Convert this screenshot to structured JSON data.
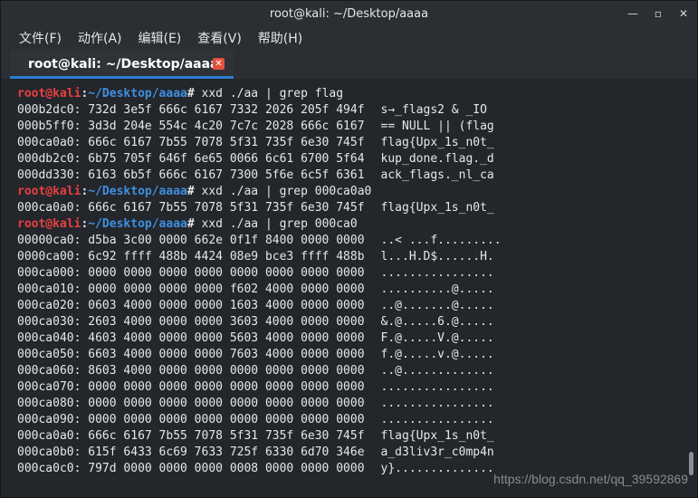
{
  "window": {
    "title": "root@kali: ~/Desktop/aaaa",
    "controls": [
      "—",
      "▫",
      "✕"
    ]
  },
  "menubar": {
    "items": [
      "文件(F)",
      "动作(A)",
      "编辑(E)",
      "查看(V)",
      "帮助(H)"
    ]
  },
  "tab": {
    "label": "root@kali: ~/Desktop/aaaa",
    "close_glyph": "✕",
    "accent_color": "#2f7bd0"
  },
  "terminal": {
    "lines": [
      {
        "type": "prompt",
        "user": "root@kali",
        "path": "~/Desktop/aaaa",
        "sep": "#",
        "cmd": "xxd ./aa | grep flag"
      },
      {
        "type": "hex",
        "addr": "000b2dc0:",
        "hex": "732d 3e5f 666c 6167 7332 2026 205f 494f",
        "ascii": "s→_flags2 & _IO"
      },
      {
        "type": "hex",
        "addr": "000b5ff0:",
        "hex": "3d3d 204e 554c 4c20 7c7c 2028 666c 6167",
        "ascii": "== NULL || (flag"
      },
      {
        "type": "hex",
        "addr": "000ca0a0:",
        "hex": "666c 6167 7b55 7078 5f31 735f 6e30 745f",
        "ascii": "flag{Upx_1s_n0t_"
      },
      {
        "type": "hex",
        "addr": "000db2c0:",
        "hex": "6b75 705f 646f 6e65 0066 6c61 6700 5f64",
        "ascii": "kup_done.flag._d"
      },
      {
        "type": "hex",
        "addr": "000dd330:",
        "hex": "6163 6b5f 666c 6167 7300 5f6e 6c5f 6361",
        "ascii": "ack_flags._nl_ca"
      },
      {
        "type": "prompt",
        "user": "root@kali",
        "path": "~/Desktop/aaaa",
        "sep": "#",
        "cmd": "xxd ./aa | grep 000ca0a0"
      },
      {
        "type": "hex",
        "addr": "000ca0a0:",
        "hex": "666c 6167 7b55 7078 5f31 735f 6e30 745f",
        "ascii": "flag{Upx_1s_n0t_"
      },
      {
        "type": "prompt",
        "user": "root@kali",
        "path": "~/Desktop/aaaa",
        "sep": "#",
        "cmd": "xxd ./aa | grep 000ca0"
      },
      {
        "type": "hex",
        "addr": "00000ca0:",
        "hex": "d5ba 3c00 0000 662e 0f1f 8400 0000 0000",
        "ascii": "..< ...f........."
      },
      {
        "type": "hex",
        "addr": "0000ca00:",
        "hex": "6c92 ffff 488b 4424 08e9 bce3 ffff 488b",
        "ascii": "l...H.D$......H."
      },
      {
        "type": "hex",
        "addr": "000ca000:",
        "hex": "0000 0000 0000 0000 0000 0000 0000 0000",
        "ascii": "................"
      },
      {
        "type": "hex",
        "addr": "000ca010:",
        "hex": "0000 0000 0000 0000 f602 4000 0000 0000",
        "ascii": "..........@....."
      },
      {
        "type": "hex",
        "addr": "000ca020:",
        "hex": "0603 4000 0000 0000 1603 4000 0000 0000",
        "ascii": "..@.......@....."
      },
      {
        "type": "hex",
        "addr": "000ca030:",
        "hex": "2603 4000 0000 0000 3603 4000 0000 0000",
        "ascii": "&.@.....6.@....."
      },
      {
        "type": "hex",
        "addr": "000ca040:",
        "hex": "4603 4000 0000 0000 5603 4000 0000 0000",
        "ascii": "F.@.....V.@....."
      },
      {
        "type": "hex",
        "addr": "000ca050:",
        "hex": "6603 4000 0000 0000 7603 4000 0000 0000",
        "ascii": "f.@.....v.@....."
      },
      {
        "type": "hex",
        "addr": "000ca060:",
        "hex": "8603 4000 0000 0000 0000 0000 0000 0000",
        "ascii": "..@............."
      },
      {
        "type": "hex",
        "addr": "000ca070:",
        "hex": "0000 0000 0000 0000 0000 0000 0000 0000",
        "ascii": "................"
      },
      {
        "type": "hex",
        "addr": "000ca080:",
        "hex": "0000 0000 0000 0000 0000 0000 0000 0000",
        "ascii": "................"
      },
      {
        "type": "hex",
        "addr": "000ca090:",
        "hex": "0000 0000 0000 0000 0000 0000 0000 0000",
        "ascii": "................"
      },
      {
        "type": "hex",
        "addr": "000ca0a0:",
        "hex": "666c 6167 7b55 7078 5f31 735f 6e30 745f",
        "ascii": "flag{Upx_1s_n0t_"
      },
      {
        "type": "hex",
        "addr": "000ca0b0:",
        "hex": "615f 6433 6c69 7633 725f 6330 6d70 346e",
        "ascii": "a_d3liv3r_c0mp4n"
      },
      {
        "type": "hex",
        "addr": "000ca0c0:",
        "hex": "797d 0000 0000 0000 0008 0000 0000 0000",
        "ascii": "y}.............."
      }
    ],
    "colors": {
      "user": "#e84040",
      "path": "#3f8fe0",
      "text": "#e7e7e7",
      "background": "#23262b"
    }
  },
  "watermark": "https://blog.csdn.net/qq_39592869"
}
